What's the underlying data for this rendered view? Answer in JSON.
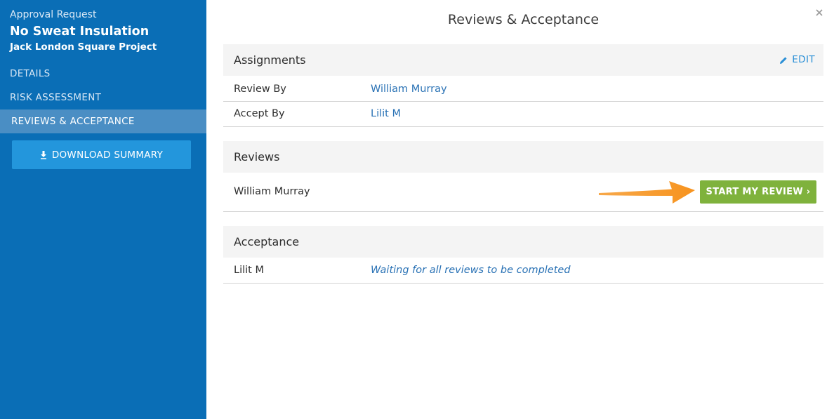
{
  "sidebar": {
    "kicker": "Approval Request",
    "title": "No Sweat Insulation",
    "subtitle": "Jack London Square Project",
    "nav": [
      {
        "label": "DETAILS"
      },
      {
        "label": "RISK ASSESSMENT"
      },
      {
        "label": "REVIEWS & ACCEPTANCE",
        "active": true
      }
    ],
    "download_label": "DOWNLOAD SUMMARY",
    "download_icon": "download-icon"
  },
  "main": {
    "title": "Reviews & Acceptance",
    "close_icon": "close-icon",
    "assignments": {
      "heading": "Assignments",
      "edit_label": "EDIT",
      "rows": [
        {
          "label": "Review By",
          "value": "William Murray"
        },
        {
          "label": "Accept By",
          "value": "Lilit M"
        }
      ]
    },
    "reviews": {
      "heading": "Reviews",
      "rows": [
        {
          "name": "William Murray",
          "action": "START MY REVIEW ›"
        }
      ]
    },
    "acceptance": {
      "heading": "Acceptance",
      "rows": [
        {
          "name": "Lilit M",
          "status": "Waiting for all reviews to be completed"
        }
      ]
    }
  },
  "colors": {
    "sidebar_bg": "#0a6eb6",
    "sidebar_active": "#4a8ec4",
    "download_btn": "#2396dc",
    "link": "#2a72b5",
    "start_btn": "#7fb23c",
    "annotation_arrow": "#f7931e"
  }
}
